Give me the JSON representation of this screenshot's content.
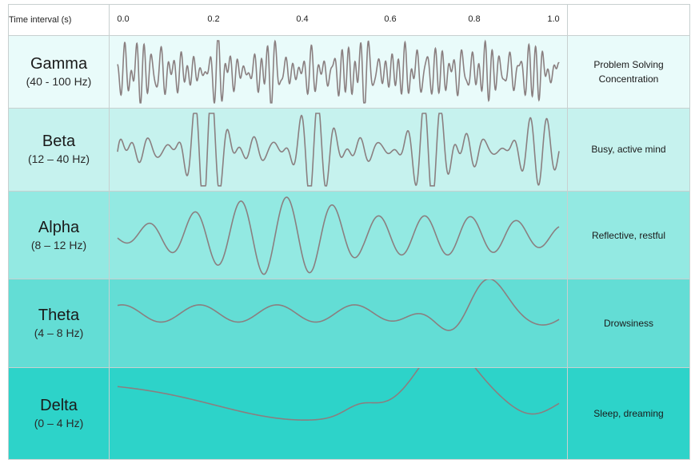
{
  "header": {
    "time_label": "Time interval (s)",
    "ticks": [
      "0.0",
      "0.2",
      "0.4",
      "0.6",
      "0.8",
      "1.0"
    ]
  },
  "bands": [
    {
      "name": "Gamma",
      "range": "(40 - 100 Hz)",
      "state": [
        "Problem Solving",
        "Concentration"
      ],
      "color": "#e9fbfa"
    },
    {
      "name": "Beta",
      "range": "(12 – 40 Hz)",
      "state": [
        "Busy, active mind"
      ],
      "color": "#c6f2ee"
    },
    {
      "name": "Alpha",
      "range": "(8 – 12 Hz)",
      "state": [
        "Reflective, restful"
      ],
      "color": "#93e9e2"
    },
    {
      "name": "Theta",
      "range": "(4 – 8 Hz)",
      "state": [
        "Drowsiness"
      ],
      "color": "#63ddd5"
    },
    {
      "name": "Delta",
      "range": "(0 – 4 Hz)",
      "state": [
        "Sleep, dreaming"
      ],
      "color": "#2dd3c9"
    }
  ],
  "colors": {
    "wave_stroke": "#8a7f80",
    "grid_border": "#c8d0d0"
  }
}
